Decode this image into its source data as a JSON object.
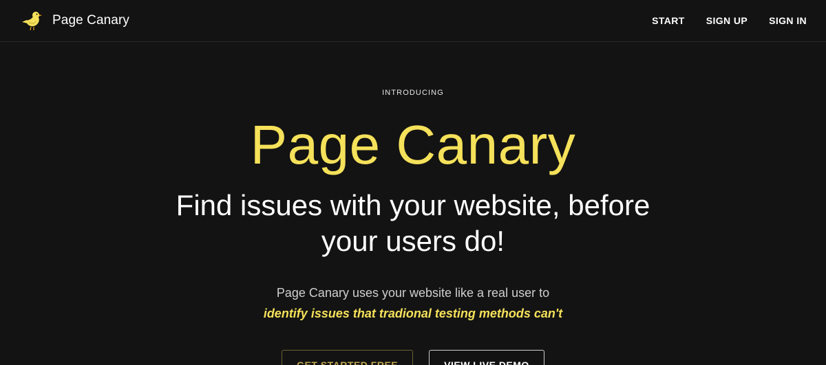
{
  "navbar": {
    "brand_name": "Page Canary",
    "links": [
      {
        "label": "START"
      },
      {
        "label": "SIGN UP"
      },
      {
        "label": "SIGN IN"
      }
    ]
  },
  "hero": {
    "eyebrow": "INTRODUCING",
    "title": "Page Canary",
    "subtitle": "Find issues with your website, before your users do!",
    "description": "Page Canary uses your website like a real user to",
    "description_emphasis": "identify issues that tradional testing methods can't",
    "primary_button": "GET STARTED FREE",
    "secondary_button": "VIEW LIVE DEMO"
  },
  "colors": {
    "background": "#131313",
    "accent": "#f5e15a",
    "text": "#ffffff"
  },
  "icons": {
    "logo": "canary-bird-icon"
  }
}
